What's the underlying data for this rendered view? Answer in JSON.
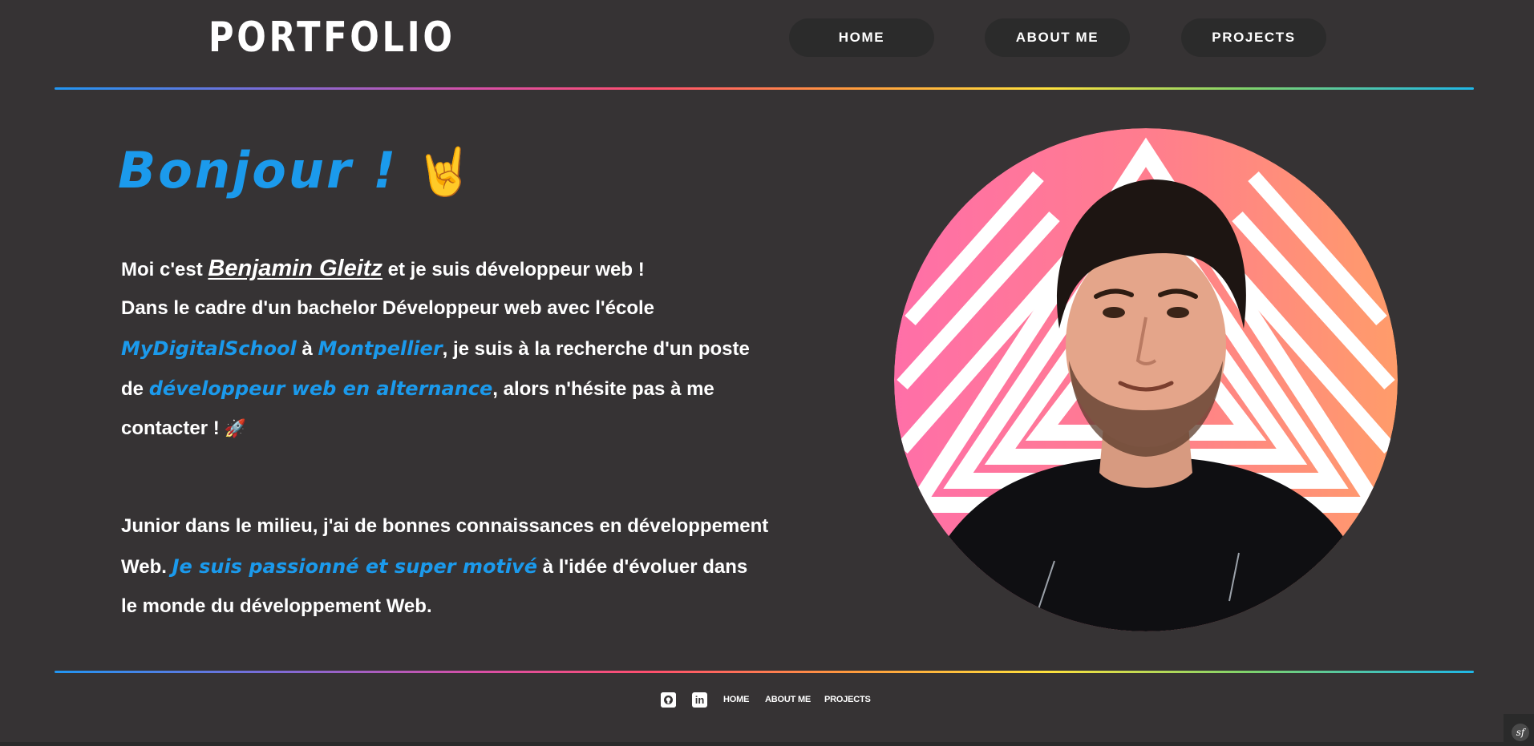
{
  "header": {
    "logo": "PORTFOLIO",
    "nav": [
      {
        "label": "HOME"
      },
      {
        "label": "ABOUT ME"
      },
      {
        "label": "PROJECTS"
      }
    ]
  },
  "hero": {
    "greeting": "Bonjour !",
    "greeting_emoji": "🤘",
    "intro": {
      "line1": {
        "before": "Moi c'est ",
        "name": "Benjamin Gleitz",
        "after": " et je suis développeur web !"
      },
      "line2": "Dans le cadre d'un bachelor Développeur web avec l'école",
      "line3": {
        "school": "MyDigitalSchool",
        "mid": " à ",
        "city": "Montpellier",
        "after": ", je suis à la recherche d'un poste"
      },
      "line4": {
        "before": "de ",
        "role": "développeur web en alternance",
        "after": ", alors n'hésite pas à me"
      },
      "line5": {
        "text": "contacter !",
        "emoji": "🚀"
      }
    },
    "junior": {
      "line1": "Junior dans le milieu, j'ai de bonnes connaissances en développement",
      "line2": {
        "before": "Web. ",
        "highlight": "Je suis passionné et super motivé",
        "after": " à l'idée d'évoluer dans"
      },
      "line3": "le monde du développement Web."
    }
  },
  "footer": {
    "github_icon": "github-icon",
    "linkedin_icon": "in",
    "links": [
      {
        "label": "HOME"
      },
      {
        "label": "ABOUT ME"
      },
      {
        "label": "PROJECTS"
      }
    ]
  },
  "colors": {
    "background": "#363334",
    "accent": "#1b9aec",
    "nav_pill": "#2b2b2b"
  }
}
